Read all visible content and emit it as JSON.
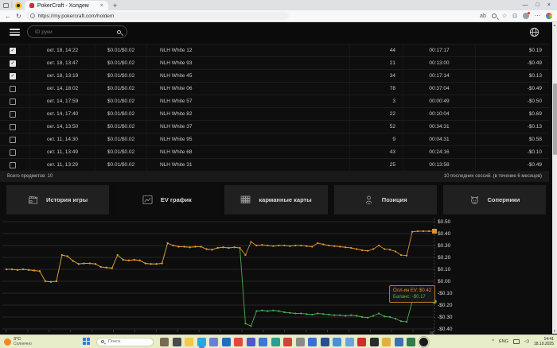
{
  "browser": {
    "tab": {
      "title": "PokerCraft - Холдем",
      "close_glyph": "×"
    },
    "new_tab_glyph": "+",
    "window_controls": {
      "minimize": "—",
      "maximize": "□",
      "close": "×"
    },
    "nav": {
      "back_glyph": "←",
      "reload_glyph": "↻",
      "site_info_glyph": "i"
    },
    "url": "https://my.pokercraft.com/holdem",
    "toolbar": {
      "translate_glyph": "ab",
      "star_glyph": "☆",
      "extensions_glyph": "⊡",
      "menu_glyph": "⋯"
    }
  },
  "header": {
    "search_placeholder": "ID руки"
  },
  "table": {
    "check_glyph": "✓",
    "rows": [
      {
        "checked": true,
        "date": "окт. 18, 14:22",
        "stakes": "$0.01/$0.02",
        "table": "NLH White 12",
        "hands": "44",
        "duration": "00:17:17",
        "result": "$0.19"
      },
      {
        "checked": true,
        "date": "окт. 18, 13:47",
        "stakes": "$0.01/$0.02",
        "table": "NLH White 93",
        "hands": "21",
        "duration": "00:13:00",
        "result": "-$0.49"
      },
      {
        "checked": true,
        "date": "окт. 18, 13:19",
        "stakes": "$0.01/$0.02",
        "table": "NLH White 45",
        "hands": "34",
        "duration": "00:17:14",
        "result": "$0.13"
      },
      {
        "checked": false,
        "date": "окт. 14, 18:02",
        "stakes": "$0.01/$0.02",
        "table": "NLH White 06",
        "hands": "78",
        "duration": "00:37:04",
        "result": "-$0.49"
      },
      {
        "checked": false,
        "date": "окт. 14, 17:59",
        "stakes": "$0.01/$0.02",
        "table": "NLH White 57",
        "hands": "3",
        "duration": "00:00:49",
        "result": "-$0.50"
      },
      {
        "checked": false,
        "date": "окт. 14, 17:40",
        "stakes": "$0.01/$0.02",
        "table": "NLH White 82",
        "hands": "22",
        "duration": "00:10:04",
        "result": "$0.69"
      },
      {
        "checked": false,
        "date": "окт. 14, 13:50",
        "stakes": "$0.01/$0.02",
        "table": "NLH White 37",
        "hands": "52",
        "duration": "00:34:31",
        "result": "-$0.13"
      },
      {
        "checked": false,
        "date": "окт. 11, 14:30",
        "stakes": "$0.01/$0.02",
        "table": "NLH White 95",
        "hands": "9",
        "duration": "00:04:31",
        "result": "$0.58"
      },
      {
        "checked": false,
        "date": "окт. 11, 13:49",
        "stakes": "$0.01/$0.02",
        "table": "NLH White 68",
        "hands": "43",
        "duration": "00:24:16",
        "result": "-$0.10"
      },
      {
        "checked": false,
        "date": "окт. 11, 13:29",
        "stakes": "$0.01/$0.02",
        "table": "NLH White 31",
        "hands": "25",
        "duration": "00:13:58",
        "result": "-$0.49"
      }
    ]
  },
  "summary": {
    "left": "Всего предметов: 10",
    "right": "10 последних сессий. (в течение 6 месяцев)"
  },
  "tabs": [
    {
      "label": "История игры",
      "icon": "clapperboard-icon",
      "active": false
    },
    {
      "label": "EV график",
      "icon": "line-chart-icon",
      "active": true
    },
    {
      "label": "карманные карты",
      "icon": "cards-grid-icon",
      "active": false
    },
    {
      "label": "Позиция",
      "icon": "position-icon",
      "active": false
    },
    {
      "label": "Соперники",
      "icon": "rivals-icon",
      "active": false
    }
  ],
  "chart_data": {
    "type": "line",
    "title": "",
    "xlabel": "",
    "ylabel": "",
    "grid": true,
    "legend_position": "none",
    "ylim": [
      -0.45,
      0.55
    ],
    "y_tick_values": [
      0.5,
      0.4,
      0.3,
      0.2,
      0.1,
      0.0,
      -0.1,
      -0.2,
      -0.3,
      -0.4
    ],
    "y_ticks": [
      "$0.50",
      "$0.40",
      "$0.30",
      "$0.20",
      "$0.10",
      "$0.00",
      "-$0.10",
      "-$0.20",
      "-$0.30",
      "-$0.40"
    ],
    "x_end_label": "00",
    "series": [
      {
        "name": "Баланс",
        "color": "#4caf50",
        "end_value": -0.17,
        "values": [
          0.1,
          0.1,
          0.095,
          0.1,
          0.095,
          0.09,
          0.085,
          0.0,
          -0.005,
          0.0,
          0.22,
          0.21,
          0.17,
          0.145,
          0.15,
          0.15,
          0.145,
          0.12,
          0.115,
          0.11,
          0.22,
          0.18,
          0.175,
          0.18,
          0.175,
          0.15,
          0.145,
          0.145,
          0.15,
          0.32,
          0.3,
          0.29,
          0.29,
          0.285,
          0.29,
          0.29,
          0.27,
          0.265,
          0.28,
          0.285,
          0.28,
          0.285,
          0.28,
          -0.355,
          -0.375,
          -0.25,
          -0.245,
          -0.25,
          -0.245,
          -0.25,
          -0.26,
          -0.265,
          -0.27,
          -0.27,
          -0.275,
          -0.28,
          -0.27,
          -0.275,
          -0.28,
          -0.285,
          -0.285,
          -0.29,
          -0.285,
          -0.29,
          -0.3,
          -0.305,
          -0.29,
          -0.27,
          -0.295,
          -0.3,
          -0.315,
          -0.335,
          -0.34,
          -0.17,
          -0.17,
          -0.17,
          -0.17,
          -0.17
        ]
      },
      {
        "name": "Олл-ин EV",
        "color": "#e0912c",
        "end_value": 0.42,
        "values": [
          0.1,
          0.1,
          0.095,
          0.1,
          0.095,
          0.09,
          0.085,
          0.0,
          -0.005,
          0.0,
          0.22,
          0.21,
          0.17,
          0.145,
          0.15,
          0.15,
          0.145,
          0.12,
          0.115,
          0.11,
          0.22,
          0.18,
          0.175,
          0.18,
          0.175,
          0.15,
          0.145,
          0.145,
          0.15,
          0.32,
          0.3,
          0.29,
          0.29,
          0.285,
          0.29,
          0.29,
          0.27,
          0.265,
          0.28,
          0.285,
          0.28,
          0.285,
          0.28,
          0.22,
          0.33,
          0.3,
          0.305,
          0.3,
          0.295,
          0.3,
          0.3,
          0.295,
          0.3,
          0.3,
          0.295,
          0.29,
          0.32,
          0.31,
          0.3,
          0.295,
          0.29,
          0.285,
          0.28,
          0.27,
          0.26,
          0.255,
          0.27,
          0.3,
          0.27,
          0.265,
          0.25,
          0.22,
          0.215,
          0.415,
          0.42,
          0.42,
          0.42,
          0.42
        ]
      }
    ]
  },
  "chart_tooltip": {
    "line1": "Олл-ин EV: $0.42",
    "line2": "Баланс: -$0.17"
  },
  "taskbar": {
    "weather": {
      "temp": "3°C",
      "condition": "Солнечно"
    },
    "search_placeholder": "Поиск",
    "icons": [
      {
        "name": "task-view",
        "color": "#7a6a52"
      },
      {
        "name": "files",
        "color": "#4a4a4a"
      },
      {
        "name": "folder",
        "color": "#f2c94c"
      },
      {
        "name": "edge",
        "color": "#2aa7e0",
        "active": true
      },
      {
        "name": "widgets",
        "color": "#6b7fd7"
      },
      {
        "name": "outlook",
        "color": "#1f6fc0"
      },
      {
        "name": "chrome",
        "color": "#e8453c"
      },
      {
        "name": "teams",
        "color": "#5059c9"
      },
      {
        "name": "contacts",
        "color": "#3b78d8"
      },
      {
        "name": "photos",
        "color": "#2d9d8f"
      },
      {
        "name": "pin",
        "color": "#d2413a"
      },
      {
        "name": "settings",
        "color": "#8a8a8a"
      },
      {
        "name": "panel",
        "color": "#3a6fd8"
      },
      {
        "name": "defender",
        "color": "#2b4d8f"
      },
      {
        "name": "monitor",
        "color": "#4a90d9"
      },
      {
        "name": "mail",
        "color": "#6aa5e0"
      },
      {
        "name": "opera",
        "color": "#cc2f2f"
      },
      {
        "name": "dark-app",
        "color": "#2b2b2b"
      },
      {
        "name": "gallery",
        "color": "#e0b23c"
      },
      {
        "name": "calculator",
        "color": "#3f6fb5"
      },
      {
        "name": "excel",
        "color": "#2f7d4f"
      },
      {
        "name": "pokercraft",
        "color": "#1a1a1a",
        "boxed": true
      }
    ],
    "tray": {
      "expand_glyph": "^",
      "lang": "ENG",
      "time": "14:41",
      "date": "18.10.2025"
    }
  }
}
